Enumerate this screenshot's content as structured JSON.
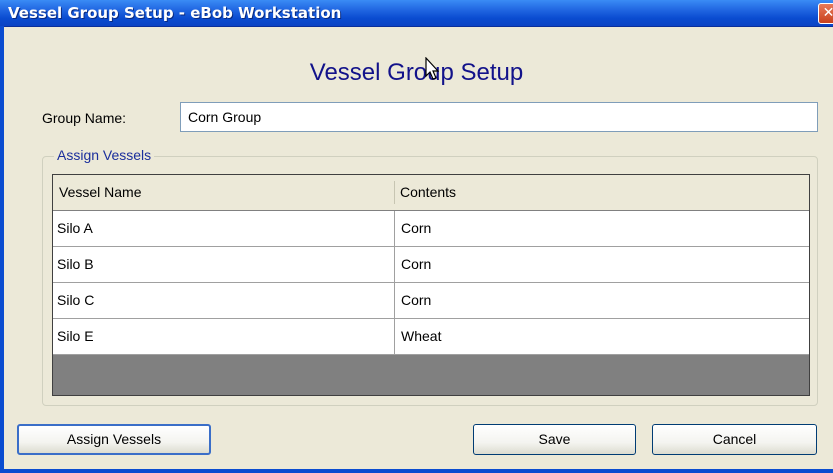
{
  "window": {
    "title": "Vessel Group Setup - eBob Workstation",
    "close_glyph": "✕"
  },
  "heading": "Vessel Group Setup",
  "group_name": {
    "label": "Group Name:",
    "value": "Corn Group"
  },
  "assign_section": {
    "legend": "Assign Vessels",
    "columns": [
      "Vessel Name",
      "Contents"
    ],
    "rows": [
      {
        "vessel": "Silo A",
        "contents": "Corn"
      },
      {
        "vessel": "Silo B",
        "contents": "Corn"
      },
      {
        "vessel": "Silo C",
        "contents": "Corn"
      },
      {
        "vessel": "Silo E",
        "contents": "Wheat"
      }
    ]
  },
  "buttons": {
    "assign": "Assign Vessels",
    "save": "Save",
    "cancel": "Cancel"
  },
  "colors": {
    "title_bar": "#0a4cd0",
    "heading": "#12128a",
    "legend": "#1a2e9c",
    "dialog_bg": "#ece9d8"
  },
  "icons": {
    "close": "close-icon",
    "cursor": "mouse-pointer-icon"
  }
}
